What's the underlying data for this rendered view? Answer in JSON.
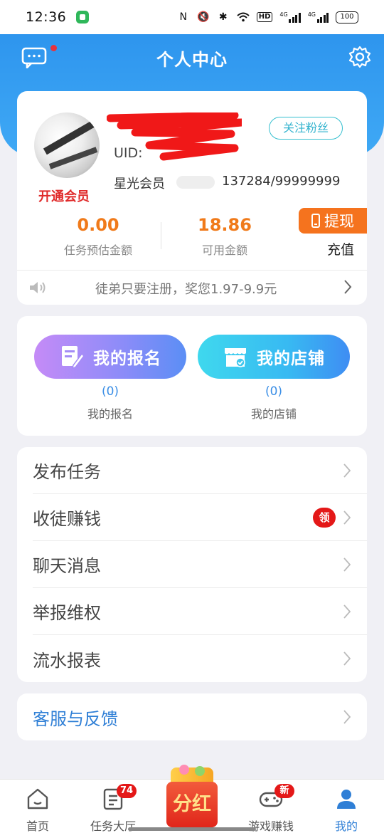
{
  "status_bar": {
    "time": "12:36",
    "battery": "100",
    "hd": "HD",
    "net1": "4G",
    "net2": "4G"
  },
  "header": {
    "title": "个人中心"
  },
  "profile": {
    "uid_prefix": "UID:",
    "vip_open": "开通会员",
    "follow_label": "关注粉丝",
    "star_member": "星光会员",
    "star_progress": "137284/99999999",
    "estimated_amount": "0.00",
    "estimated_label": "任务预估金额",
    "available_amount": "18.86",
    "available_label": "可用金额",
    "withdraw_label": "提现",
    "recharge_label": "充值",
    "notice": "徒弟只要注册，奖您1.97-9.9元"
  },
  "actions": {
    "signup_label": "我的报名",
    "signup_count": "(0)",
    "signup_caption": "我的报名",
    "shop_label": "我的店铺",
    "shop_count": "(0)",
    "shop_caption": "我的店铺"
  },
  "menu": {
    "items": [
      {
        "label": "发布任务"
      },
      {
        "label": "收徒赚钱",
        "badge": "领"
      },
      {
        "label": "聊天消息"
      },
      {
        "label": "举报维权"
      },
      {
        "label": "流水报表"
      }
    ]
  },
  "service": {
    "label": "客服与反馈"
  },
  "nav": {
    "home": "首页",
    "task_hall": "任务大厅",
    "task_badge": "74",
    "dividend": "分红",
    "game": "游戏赚钱",
    "game_badge": "新",
    "mine": "我的"
  },
  "colors": {
    "header_blue": "#3fa9f5",
    "accent_orange": "#f5731e",
    "accent_red": "#e41818",
    "link_blue": "#2f7fd6"
  }
}
